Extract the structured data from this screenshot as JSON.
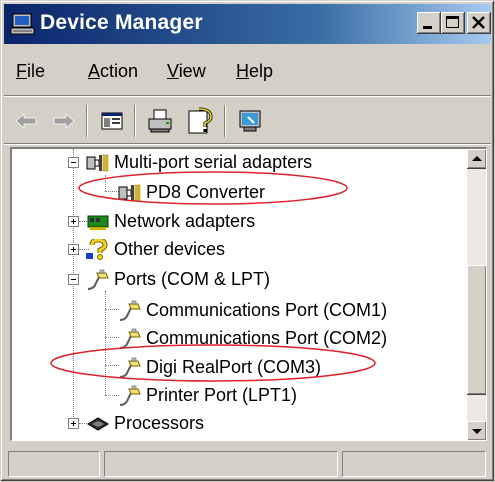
{
  "window": {
    "title": "Device Manager"
  },
  "menu": {
    "items": [
      {
        "label": "File",
        "mnemonic": "F"
      },
      {
        "label": "Action",
        "mnemonic": "A"
      },
      {
        "label": "View",
        "mnemonic": "V"
      },
      {
        "label": "Help",
        "mnemonic": "H"
      }
    ]
  },
  "toolbar": {
    "buttons": [
      {
        "icon": "back-arrow-icon",
        "enabled": false
      },
      {
        "icon": "forward-arrow-icon",
        "enabled": false
      },
      {
        "icon": "show-hide-console-tree-icon"
      },
      {
        "icon": "print-icon"
      },
      {
        "icon": "help-icon"
      },
      {
        "icon": "properties-icon"
      }
    ]
  },
  "tree": {
    "items": [
      {
        "label": "Multi-port serial adapters",
        "icon": "serial-adapter-icon",
        "expanded": true
      },
      {
        "label": "PD8 Converter",
        "icon": "serial-adapter-icon",
        "highlighted": true
      },
      {
        "label": "Network adapters",
        "icon": "network-adapter-icon",
        "expanded": false
      },
      {
        "label": "Other devices",
        "icon": "question-mark-icon",
        "expanded": false
      },
      {
        "label": "Ports (COM & LPT)",
        "icon": "port-connector-icon",
        "expanded": true
      },
      {
        "label": "Communications Port (COM1)",
        "icon": "port-connector-icon"
      },
      {
        "label": "Communications Port (COM2)",
        "icon": "port-connector-icon"
      },
      {
        "label": "Digi RealPort (COM3)",
        "icon": "port-connector-icon",
        "highlighted": true
      },
      {
        "label": "Printer Port (LPT1)",
        "icon": "port-connector-icon"
      },
      {
        "label": "Processors",
        "icon": "processor-chip-icon",
        "expanded": false
      }
    ]
  },
  "annotation": {
    "highlight_color": "#e0202a"
  }
}
